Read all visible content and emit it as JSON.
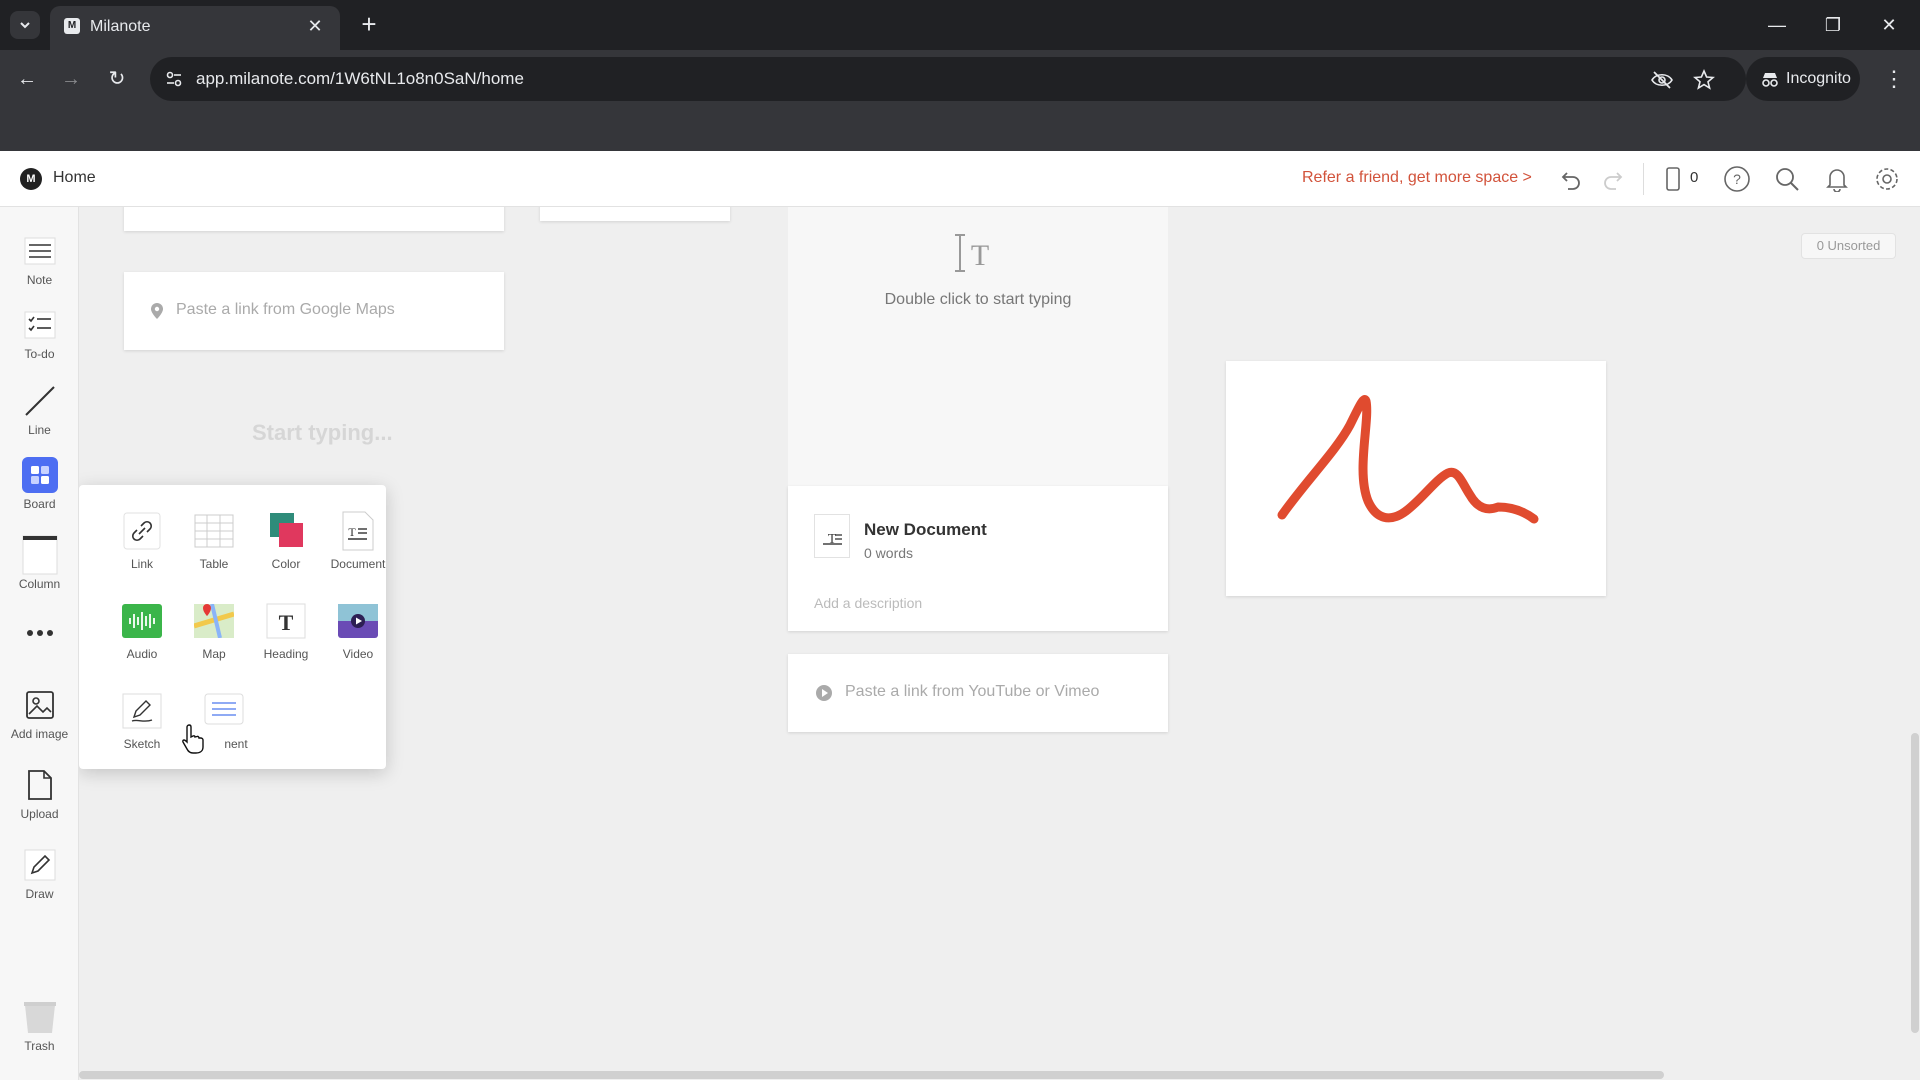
{
  "browser": {
    "tab_title": "Milanote",
    "tab_favicon": "M",
    "url": "app.milanote.com/1W6tNL1o8n0SaN/home",
    "incognito_label": "Incognito"
  },
  "header": {
    "logo": "M",
    "home_label": "Home",
    "refer_link": "Refer a friend, get more space >",
    "device_count": "0"
  },
  "sidebar": {
    "note": "Note",
    "todo": "To-do",
    "line": "Line",
    "board": "Board",
    "column": "Column",
    "add_image": "Add image",
    "upload": "Upload",
    "draw": "Draw",
    "trash": "Trash"
  },
  "canvas": {
    "maps_placeholder": "Paste a link from Google Maps",
    "start_typing": "Start typing...",
    "text_hint": "Double click to start typing",
    "doc_title": "New Document",
    "doc_words": "0 words",
    "doc_description_placeholder": "Add a description",
    "video_placeholder": "Paste a link from YouTube or Vimeo",
    "unsorted": "0 Unsorted"
  },
  "popup": {
    "items": [
      {
        "label": "Link",
        "icon": "link-icon"
      },
      {
        "label": "Table",
        "icon": "table-icon"
      },
      {
        "label": "Color",
        "icon": "color-swatch-icon"
      },
      {
        "label": "Document",
        "icon": "document-icon"
      },
      {
        "label": "Audio",
        "icon": "audio-icon"
      },
      {
        "label": "Map",
        "icon": "map-icon"
      },
      {
        "label": "Heading",
        "icon": "heading-icon"
      },
      {
        "label": "Video",
        "icon": "video-icon"
      },
      {
        "label": "Sketch",
        "icon": "sketch-icon"
      },
      {
        "label": "nent",
        "icon": "comment-icon"
      }
    ]
  },
  "colors": {
    "accent": "#d2533b",
    "board_blue": "#4d6ef2",
    "sketch_stroke": "#e04b2f",
    "chrome_dark": "#202124"
  }
}
